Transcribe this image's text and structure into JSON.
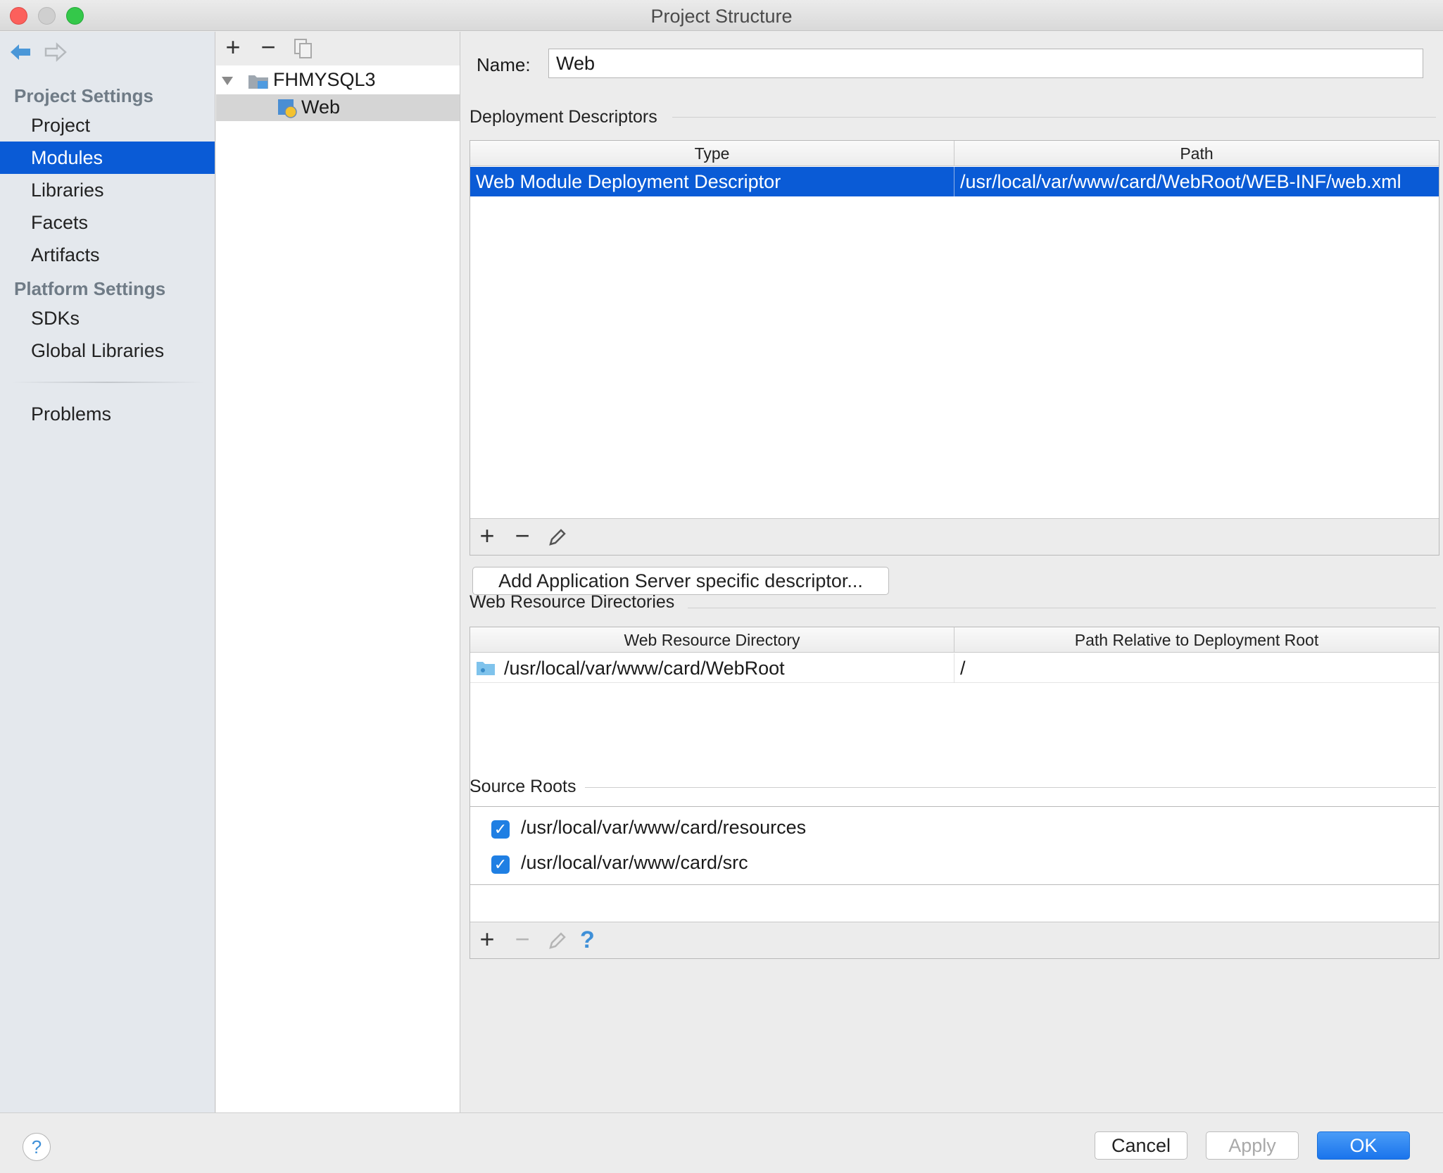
{
  "window": {
    "title": "Project Structure"
  },
  "nav": {
    "back_icon": "back-arrow-icon",
    "forward_icon": "forward-arrow-icon"
  },
  "sidebar": {
    "project_settings_heading": "Project Settings",
    "platform_settings_heading": "Platform Settings",
    "items": [
      {
        "label": "Project"
      },
      {
        "label": "Modules",
        "selected": true
      },
      {
        "label": "Libraries"
      },
      {
        "label": "Facets"
      },
      {
        "label": "Artifacts"
      },
      {
        "label": "SDKs"
      },
      {
        "label": "Global Libraries"
      },
      {
        "label": "Problems"
      }
    ]
  },
  "tree": {
    "toolbar": {
      "add": "+",
      "remove": "−"
    },
    "root": {
      "label": "FHMYSQL3"
    },
    "child": {
      "label": "Web",
      "selected": true
    }
  },
  "main": {
    "name_label": "Name:",
    "name_value": "Web",
    "deployment": {
      "title": "Deployment Descriptors",
      "columns": [
        "Type",
        "Path"
      ],
      "rows": [
        {
          "type": "Web Module Deployment Descriptor",
          "path": "/usr/local/var/www/card/WebRoot/WEB-INF/web.xml"
        }
      ],
      "footer": {
        "add": "+",
        "remove": "−"
      },
      "add_server_button": "Add Application Server specific descriptor..."
    },
    "web_resources": {
      "title": "Web Resource Directories",
      "columns": [
        "Web Resource Directory",
        "Path Relative to Deployment Root"
      ],
      "rows": [
        {
          "directory": "/usr/local/var/www/card/WebRoot",
          "relative": "/"
        }
      ],
      "footer": {
        "add": "+",
        "remove": "−",
        "help": "?"
      }
    },
    "source_roots": {
      "title": "Source Roots",
      "items": [
        {
          "path": "/usr/local/var/www/card/resources",
          "checked": true
        },
        {
          "path": "/usr/local/var/www/card/src",
          "checked": true
        }
      ]
    }
  },
  "footer": {
    "help": "?",
    "cancel": "Cancel",
    "apply": "Apply",
    "ok": "OK"
  },
  "colors": {
    "selection": "#0a5bd6",
    "ok_button": "#1d7cf2",
    "checkbox": "#1f7fe3"
  }
}
